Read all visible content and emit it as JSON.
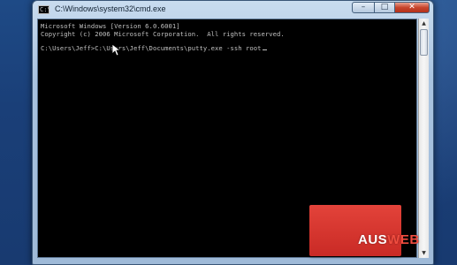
{
  "window": {
    "title": "C:\\Windows\\system32\\cmd.exe",
    "icon": "cmd-icon",
    "controls": {
      "minimize": "–",
      "maximize": "□",
      "close": "✕"
    }
  },
  "console": {
    "lines": [
      "Microsoft Windows [Version 6.0.6001]",
      "Copyright (c) 2006 Microsoft Corporation.  All rights reserved.",
      "",
      "C:\\Users\\Jeff>C:\\Users\\Jeff\\Documents\\putty.exe -ssh root"
    ],
    "text_color": "#c0c0c0",
    "background": "#000000"
  },
  "scrollbar": {
    "up": "▲",
    "down": "▼"
  },
  "watermark": {
    "part1": "AUS",
    "part2": "WEB",
    "box_color": "#d9332c"
  }
}
